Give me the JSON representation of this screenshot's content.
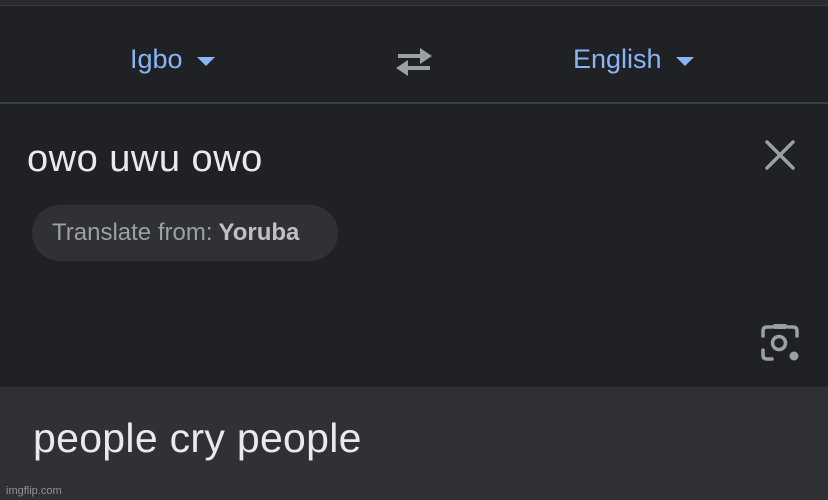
{
  "header": {
    "source_language": "Igbo",
    "target_language": "English",
    "swap_icon": "swap-arrows-icon"
  },
  "input": {
    "text": "owo uwu owo",
    "clear_icon": "close-icon",
    "suggestion": {
      "prefix": "Translate from:",
      "language": "Yoruba"
    },
    "camera_icon": "lens-camera-icon"
  },
  "output": {
    "text": "people cry people"
  },
  "watermark": "imgflip.com",
  "colors": {
    "background": "#202124",
    "output_background": "#303134",
    "accent": "#8ab4f8",
    "text": "#e8eaed",
    "muted": "#9aa0a6"
  }
}
